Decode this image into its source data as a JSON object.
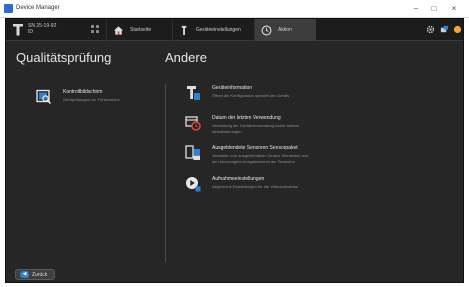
{
  "window": {
    "title": "Device Manager"
  },
  "device": {
    "line1": "SN 25-19-92",
    "line2": "ID"
  },
  "nav": {
    "tabs": [
      {
        "label": "Startseite",
        "icon": "home-icon"
      },
      {
        "label": "Geräteeinstellungen",
        "icon": "wrench-icon"
      },
      {
        "label": "Aktion",
        "icon": "clock-icon"
      }
    ]
  },
  "left_section": {
    "title": "Qualitätsprüfung",
    "items": [
      {
        "title": "Kontrollbildschirm",
        "description": "Sichtprüfungen zur Fehlersuche",
        "icon": "monitor-check-icon"
      }
    ]
  },
  "right_section": {
    "title": "Andere",
    "items": [
      {
        "title": "Geräteinformation",
        "description": "Öffnet die Konfiguration speziell des Geräts",
        "icon": "device-info-icon"
      },
      {
        "title": "Datum der letzten Verwendung",
        "description": "Verwaltung der Geräteverwendung sowie weitere Aktualisierungen",
        "icon": "calendar-clock-icon"
      },
      {
        "title": "Ausgeblendete Sensoren Sensorpaket",
        "description": "Verwalten von ausgeblendeten Sensor Elementen und den bevorzugten Ausgabeformat der Sensoren",
        "icon": "sensor-package-icon"
      },
      {
        "title": "Aufnahmeeinstellungen",
        "description": "Allgemeine Einstellungen für die Videoaufnahme",
        "icon": "video-settings-icon"
      }
    ]
  },
  "footer": {
    "back_label": "Zurück"
  },
  "colors": {
    "accent": "#2f7fd4",
    "background": "#262626"
  }
}
